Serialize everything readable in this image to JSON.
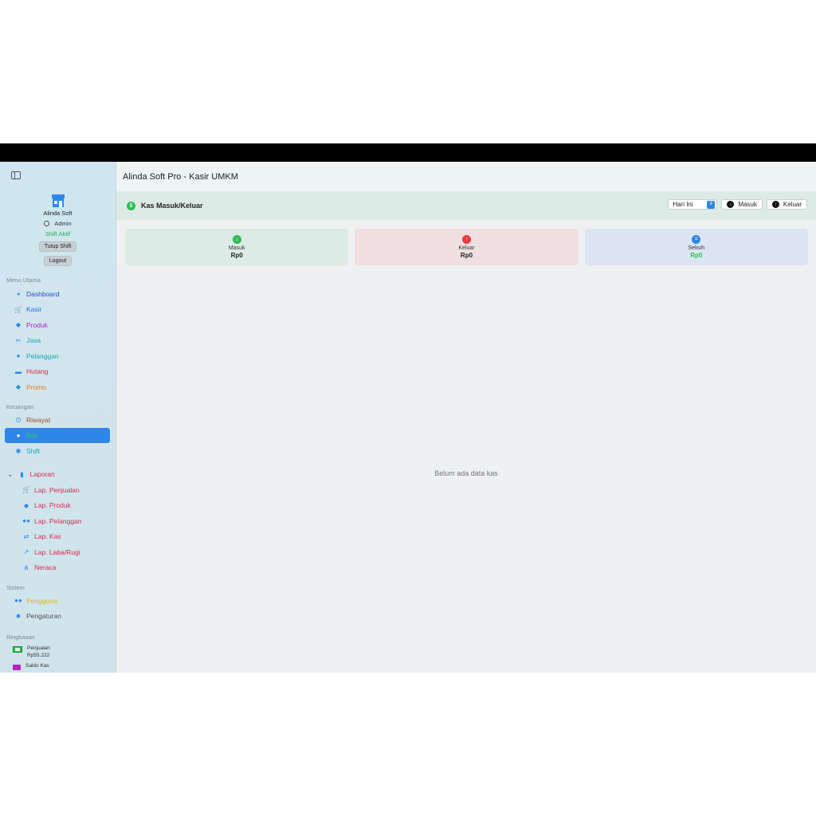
{
  "app": {
    "title": "Alinda Soft Pro - Kasir UMKM"
  },
  "profile": {
    "name": "Alinda Soft",
    "role": "Admin",
    "status": "Shift Aktif",
    "close_shift": "Tutup Shift",
    "logout": "Logout"
  },
  "sections": {
    "main": "Menu Utama",
    "finance": "Keuangan",
    "system": "Sistem",
    "summary": "Ringkasan"
  },
  "menu_main": [
    {
      "label": "Dashboard",
      "color": "#2b48c9",
      "icon": "dashboard-icon"
    },
    {
      "label": "Kasir",
      "color": "#2f6bd8",
      "icon": "cart-icon"
    },
    {
      "label": "Produk",
      "color": "#b325c2",
      "icon": "box-icon"
    },
    {
      "label": "Jasa",
      "color": "#1aa6b7",
      "icon": "tools-icon"
    },
    {
      "label": "Pelanggan",
      "color": "#1aa6b7",
      "icon": "user-icon"
    },
    {
      "label": "Hutang",
      "color": "#e0284f",
      "icon": "card-icon"
    },
    {
      "label": "Promo",
      "color": "#ee7b16",
      "icon": "tag-icon"
    }
  ],
  "menu_finance": [
    {
      "label": "Riwayat",
      "color": "#a1502a",
      "icon": "history-icon"
    },
    {
      "label": "Kas",
      "color": "#2fcf5a",
      "icon": "cash-icon",
      "active": true
    },
    {
      "label": "Shift",
      "color": "#1aa6b7",
      "icon": "shift-icon"
    },
    {
      "label": "Laporan",
      "color": "#e0284f",
      "icon": "chart-icon"
    },
    {
      "label": "Lap. Penjualan",
      "color": "#e0284f",
      "icon": "cart-icon"
    },
    {
      "label": "Lap. Produk",
      "color": "#e0284f",
      "icon": "box-icon"
    },
    {
      "label": "Lap. Pelanggan",
      "color": "#e0284f",
      "icon": "users-icon"
    },
    {
      "label": "Lap. Kas",
      "color": "#e0284f",
      "icon": "exchange-icon"
    },
    {
      "label": "Lap. Laba/Rugi",
      "color": "#e0284f",
      "icon": "trend-icon"
    },
    {
      "label": "Neraca",
      "color": "#e0284f",
      "icon": "network-icon"
    }
  ],
  "menu_system": [
    {
      "label": "Pengguna",
      "color": "#e6b800",
      "icon": "users-icon"
    },
    {
      "label": "Pengaturan",
      "color": "#555555",
      "icon": "gear-icon"
    }
  ],
  "summary": [
    {
      "label": "Penjualan",
      "value": "Rp55.222"
    },
    {
      "label": "Saldo Kas",
      "value": ""
    }
  ],
  "page": {
    "title": "Kas Masuk/Keluar",
    "period": "Hari Ini",
    "btn_in": "Masuk",
    "btn_out": "Keluar",
    "cards": [
      {
        "label": "Masuk",
        "value": "Rp0",
        "bg": "#dcebe5",
        "icon_bg": "#2fbe55",
        "value_color": "#222"
      },
      {
        "label": "Keluar",
        "value": "Rp0",
        "bg": "#efdfe1",
        "icon_bg": "#ec3b3b",
        "value_color": "#222"
      },
      {
        "label": "Selisih",
        "value": "Rp0",
        "bg": "#dbe5f2",
        "icon_bg": "#2f86ea",
        "value_color": "#2fbe55"
      }
    ],
    "empty": "Belum ada data kas"
  }
}
